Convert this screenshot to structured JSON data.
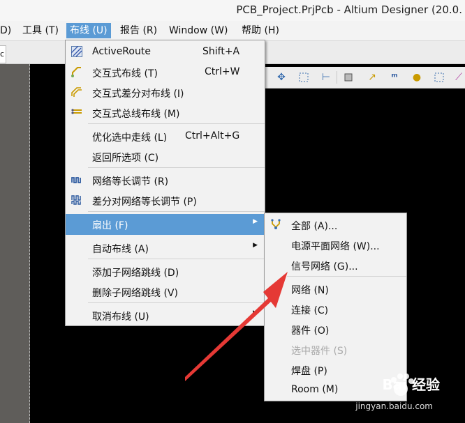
{
  "window": {
    "title": "PCB_Project.PrjPcb - Altium Designer (20.0."
  },
  "menubar": [
    {
      "label": "D)"
    },
    {
      "label": "工具 (T)"
    },
    {
      "label": "布线 (U)"
    },
    {
      "label": "报告 (R)"
    },
    {
      "label": "Window (W)"
    },
    {
      "label": "帮助 (H)"
    }
  ],
  "tab_stub": "c",
  "route_menu": {
    "items": [
      {
        "label": "ActiveRoute",
        "shortcut": "Shift+A",
        "icon": "activeroute-icon"
      },
      {
        "label": "交互式布线 (T)",
        "shortcut": "Ctrl+W",
        "icon": "interactive-route-icon"
      },
      {
        "label": "交互式差分对布线 (I)",
        "shortcut": "",
        "icon": "diff-pair-route-icon"
      },
      {
        "label": "交互式总线布线 (M)",
        "shortcut": "",
        "icon": "bus-route-icon"
      },
      {
        "label": "优化选中走线 (L)",
        "shortcut": "Ctrl+Alt+G",
        "icon": ""
      },
      {
        "label": "返回所选项 (C)",
        "shortcut": "",
        "icon": ""
      },
      {
        "label": "网络等长调节 (R)",
        "shortcut": "",
        "icon": "length-tuning-icon"
      },
      {
        "label": "差分对网络等长调节 (P)",
        "shortcut": "",
        "icon": "diff-length-tuning-icon"
      },
      {
        "label": "扇出 (F)",
        "shortcut": "",
        "icon": ""
      },
      {
        "label": "自动布线 (A)",
        "shortcut": "",
        "icon": ""
      },
      {
        "label": "添加子网络跳线 (D)",
        "shortcut": "",
        "icon": ""
      },
      {
        "label": "删除子网络跳线 (V)",
        "shortcut": "",
        "icon": ""
      },
      {
        "label": "取消布线 (U)",
        "shortcut": "",
        "icon": ""
      }
    ]
  },
  "fanout_menu": {
    "items": [
      {
        "label": "全部 (A)...",
        "icon": "fanout-icon"
      },
      {
        "label": "电源平面网络 (W)..."
      },
      {
        "label": "信号网络 (G)..."
      },
      {
        "label": "网络 (N)"
      },
      {
        "label": "连接 (C)"
      },
      {
        "label": "器件 (O)"
      },
      {
        "label": "选中器件 (S)"
      },
      {
        "label": "焊盘 (P)"
      },
      {
        "label": "Room (M)"
      }
    ]
  },
  "watermark": {
    "brand": "Bai 经验",
    "url": "jingyan.baidu.com"
  },
  "colors": {
    "highlight": "#5b9bd5",
    "annotation_arrow": "#e53935"
  }
}
